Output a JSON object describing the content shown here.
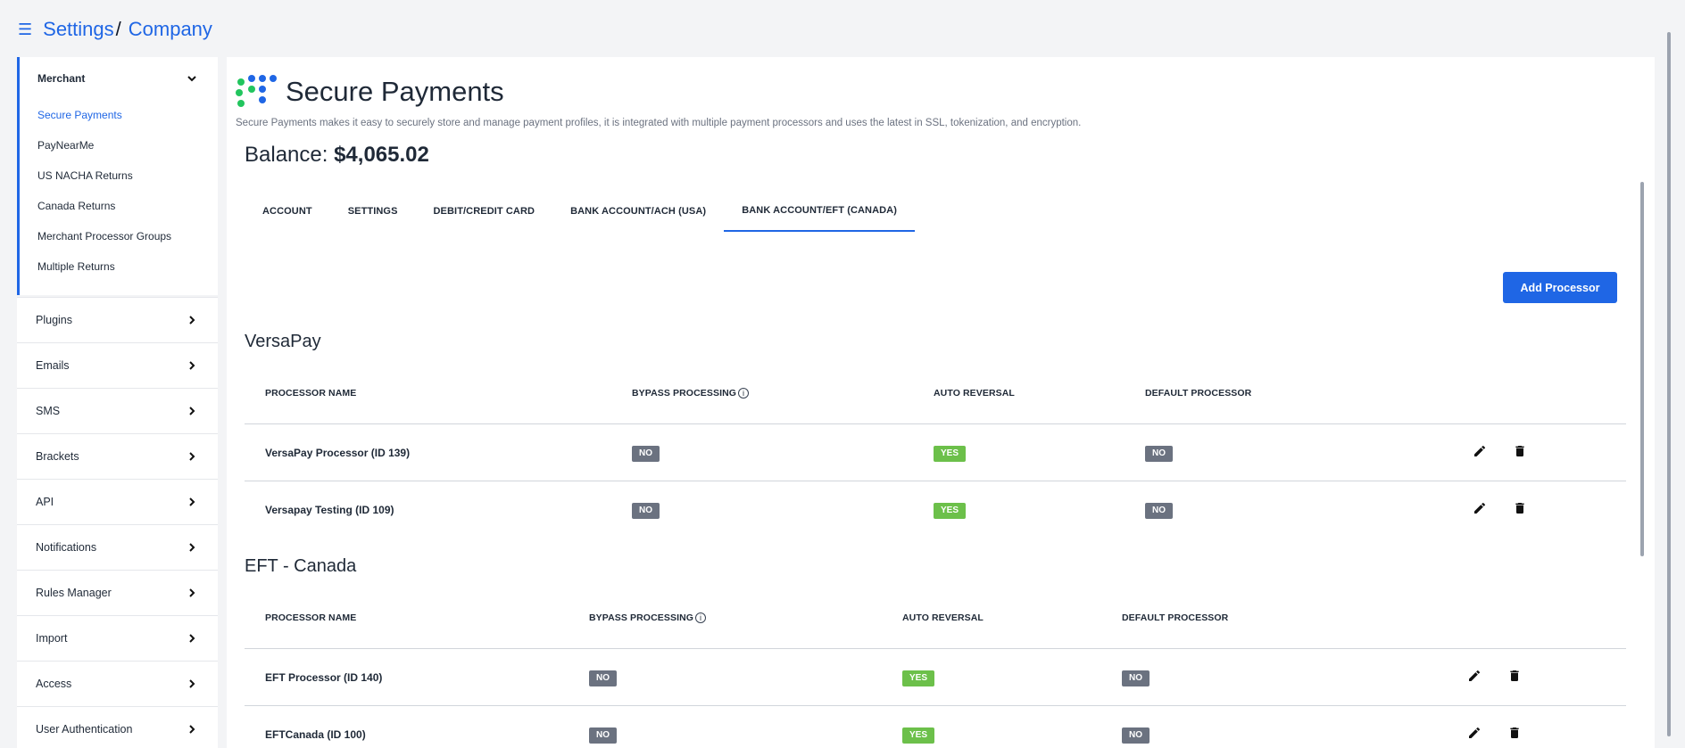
{
  "header": {
    "menu_icon": "hamburger-icon",
    "breadcrumb": [
      "Settings",
      "Company"
    ],
    "separator": "/"
  },
  "sidebar": {
    "merchant": {
      "title": "Merchant",
      "items": [
        {
          "label": "Secure Payments",
          "active": true
        },
        {
          "label": "PayNearMe",
          "active": false
        },
        {
          "label": "US NACHA Returns",
          "active": false
        },
        {
          "label": "Canada Returns",
          "active": false
        },
        {
          "label": "Merchant Processor Groups",
          "active": false
        },
        {
          "label": "Multiple Returns",
          "active": false
        }
      ]
    },
    "items": [
      {
        "label": "Plugins"
      },
      {
        "label": "Emails"
      },
      {
        "label": "SMS"
      },
      {
        "label": "Brackets"
      },
      {
        "label": "API"
      },
      {
        "label": "Notifications"
      },
      {
        "label": "Rules Manager"
      },
      {
        "label": "Import"
      },
      {
        "label": "Access"
      },
      {
        "label": "User Authentication"
      }
    ]
  },
  "main": {
    "title": "Secure Payments",
    "description": "Secure Payments makes it easy to securely store and manage payment profiles, it is integrated with multiple payment processors and uses the latest in SSL, tokenization, and encryption.",
    "balance_label": "Balance:",
    "balance_value": "$4,065.02",
    "tabs": [
      {
        "label": "ACCOUNT",
        "active": false
      },
      {
        "label": "SETTINGS",
        "active": false
      },
      {
        "label": "DEBIT/CREDIT CARD",
        "active": false
      },
      {
        "label": "BANK ACCOUNT/ACH (USA)",
        "active": false
      },
      {
        "label": "BANK ACCOUNT/EFT (CANADA)",
        "active": true
      }
    ],
    "add_button": "Add Processor",
    "columns": {
      "name": "PROCESSOR NAME",
      "bypass": "BYPASS PROCESSING",
      "auto_reversal": "AUTO REVERSAL",
      "default": "DEFAULT PROCESSOR"
    },
    "sections": [
      {
        "title": "VersaPay",
        "rows": [
          {
            "name": "VersaPay Processor (ID 139)",
            "bypass": "NO",
            "auto_reversal": "YES",
            "default": "NO"
          },
          {
            "name": "Versapay Testing (ID 109)",
            "bypass": "NO",
            "auto_reversal": "YES",
            "default": "NO"
          }
        ]
      },
      {
        "title": "EFT - Canada",
        "rows": [
          {
            "name": "EFT Processor (ID 140)",
            "bypass": "NO",
            "auto_reversal": "YES",
            "default": "NO"
          },
          {
            "name": "EFTCanada (ID 100)",
            "bypass": "NO",
            "auto_reversal": "YES",
            "default": "NO"
          }
        ]
      }
    ],
    "icons": {
      "edit": "pencil-icon",
      "delete": "trash-icon",
      "info": "info-icon"
    }
  },
  "colors": {
    "accent": "#1f66e5",
    "yes_badge": "#6cc04a",
    "no_badge": "#6b7280",
    "logo_green": "#22c55e",
    "logo_blue": "#1f66e5"
  }
}
